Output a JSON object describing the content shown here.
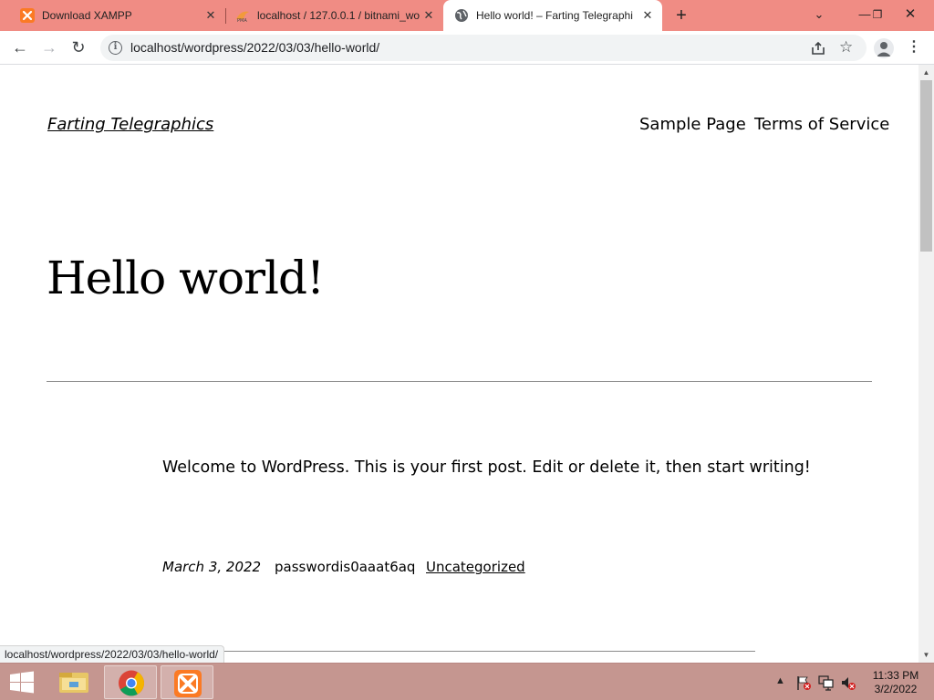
{
  "browser": {
    "tabs": [
      {
        "title": "Download XAMPP",
        "favicon": "xampp-icon",
        "active": false
      },
      {
        "title": "localhost / 127.0.0.1 / bitnami_wo",
        "favicon": "phpmyadmin-icon",
        "active": false
      },
      {
        "title": "Hello world! – Farting Telegraphi",
        "favicon": "globe-icon",
        "active": true
      }
    ],
    "new_tab": "+",
    "address": "localhost/wordpress/2022/03/03/hello-world/",
    "status_url": "localhost/wordpress/2022/03/03/hello-world/",
    "colors": {
      "tabstrip": "#f08c84",
      "omnibox": "#f1f3f4",
      "taskbar": "#c59690"
    }
  },
  "page": {
    "site_title": "Farting Telegraphics",
    "nav": [
      "Sample Page",
      "Terms of Service"
    ],
    "post_title": "Hello world!",
    "body": "Welcome to WordPress. This is your first post. Edit or delete it, then start writing!",
    "meta": {
      "date": "March 3, 2022",
      "author": "passwordis0aaat6aq",
      "category": "Uncategorized"
    }
  },
  "taskbar": {
    "apps": [
      "file-explorer-icon",
      "chrome-icon",
      "xampp-icon"
    ],
    "time": "11:33 PM",
    "date": "3/2/2022"
  }
}
